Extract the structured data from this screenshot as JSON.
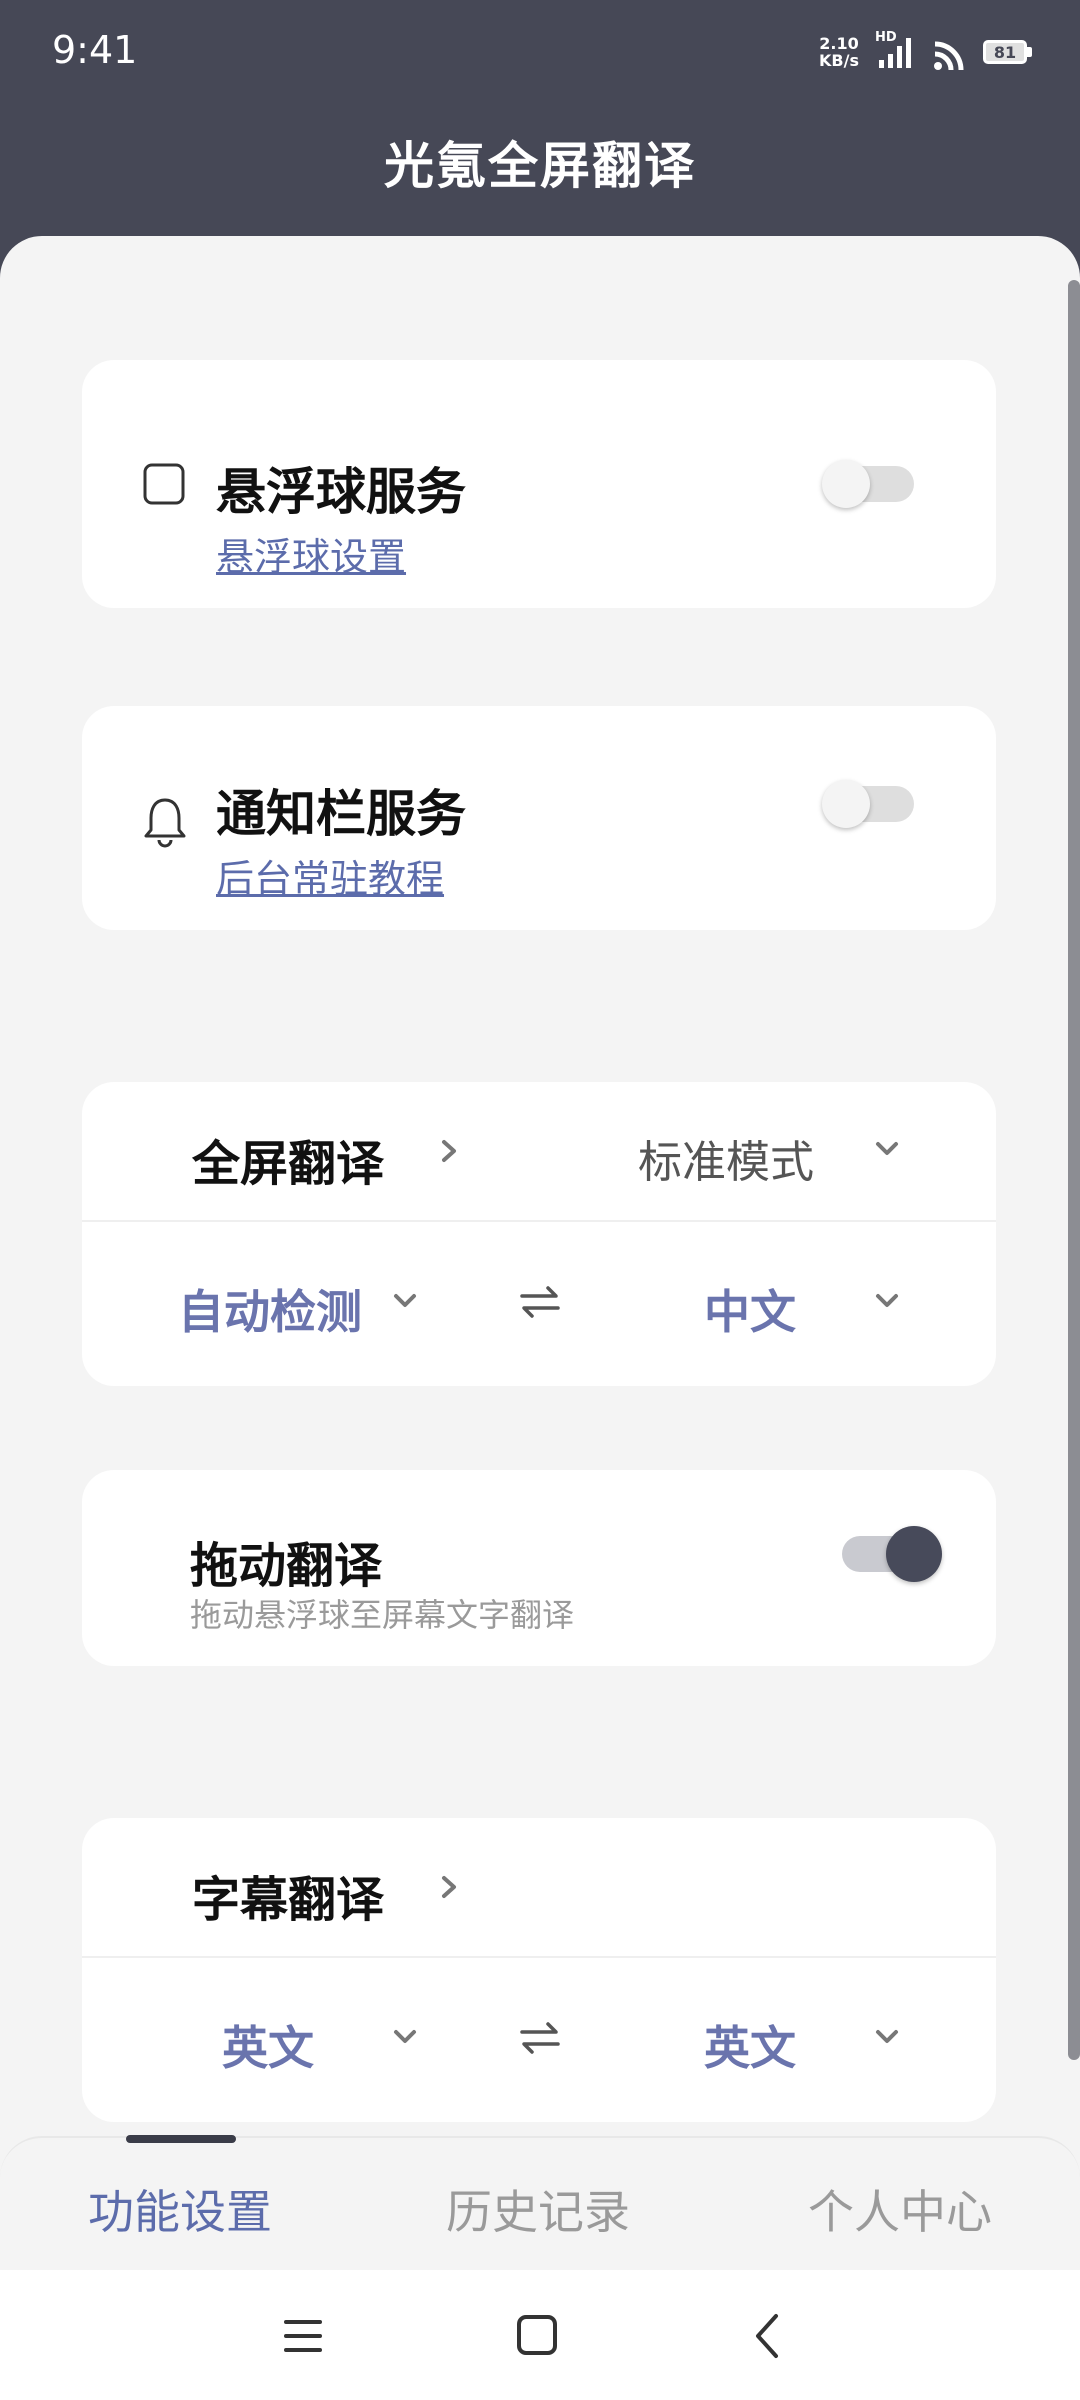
{
  "status_bar": {
    "time": "9:41",
    "net_speed_value": "2.10",
    "net_speed_unit": "KB/s",
    "network_label": "HD",
    "battery": "81"
  },
  "header": {
    "title": "光氪全屏翻译"
  },
  "floating_ball": {
    "title": "悬浮球服务",
    "link": "悬浮球设置",
    "enabled": false
  },
  "notification": {
    "title": "通知栏服务",
    "link": "后台常驻教程",
    "enabled": false
  },
  "fullscreen": {
    "title": "全屏翻译",
    "mode": "标准模式",
    "source_lang": "自动检测",
    "target_lang": "中文"
  },
  "drag": {
    "title": "拖动翻译",
    "description": "拖动悬浮球至屏幕文字翻译",
    "enabled": true
  },
  "subtitle": {
    "title": "字幕翻译",
    "source_lang": "英文",
    "target_lang": "英文"
  },
  "tabs": [
    {
      "label": "功能设置",
      "active": true
    },
    {
      "label": "历史记录",
      "active": false
    },
    {
      "label": "个人中心",
      "active": false
    }
  ],
  "colors": {
    "header_bg": "#464856",
    "accent": "#5c6cab",
    "lang_text": "#6a74ad",
    "toggle_on": "#474a5a"
  }
}
